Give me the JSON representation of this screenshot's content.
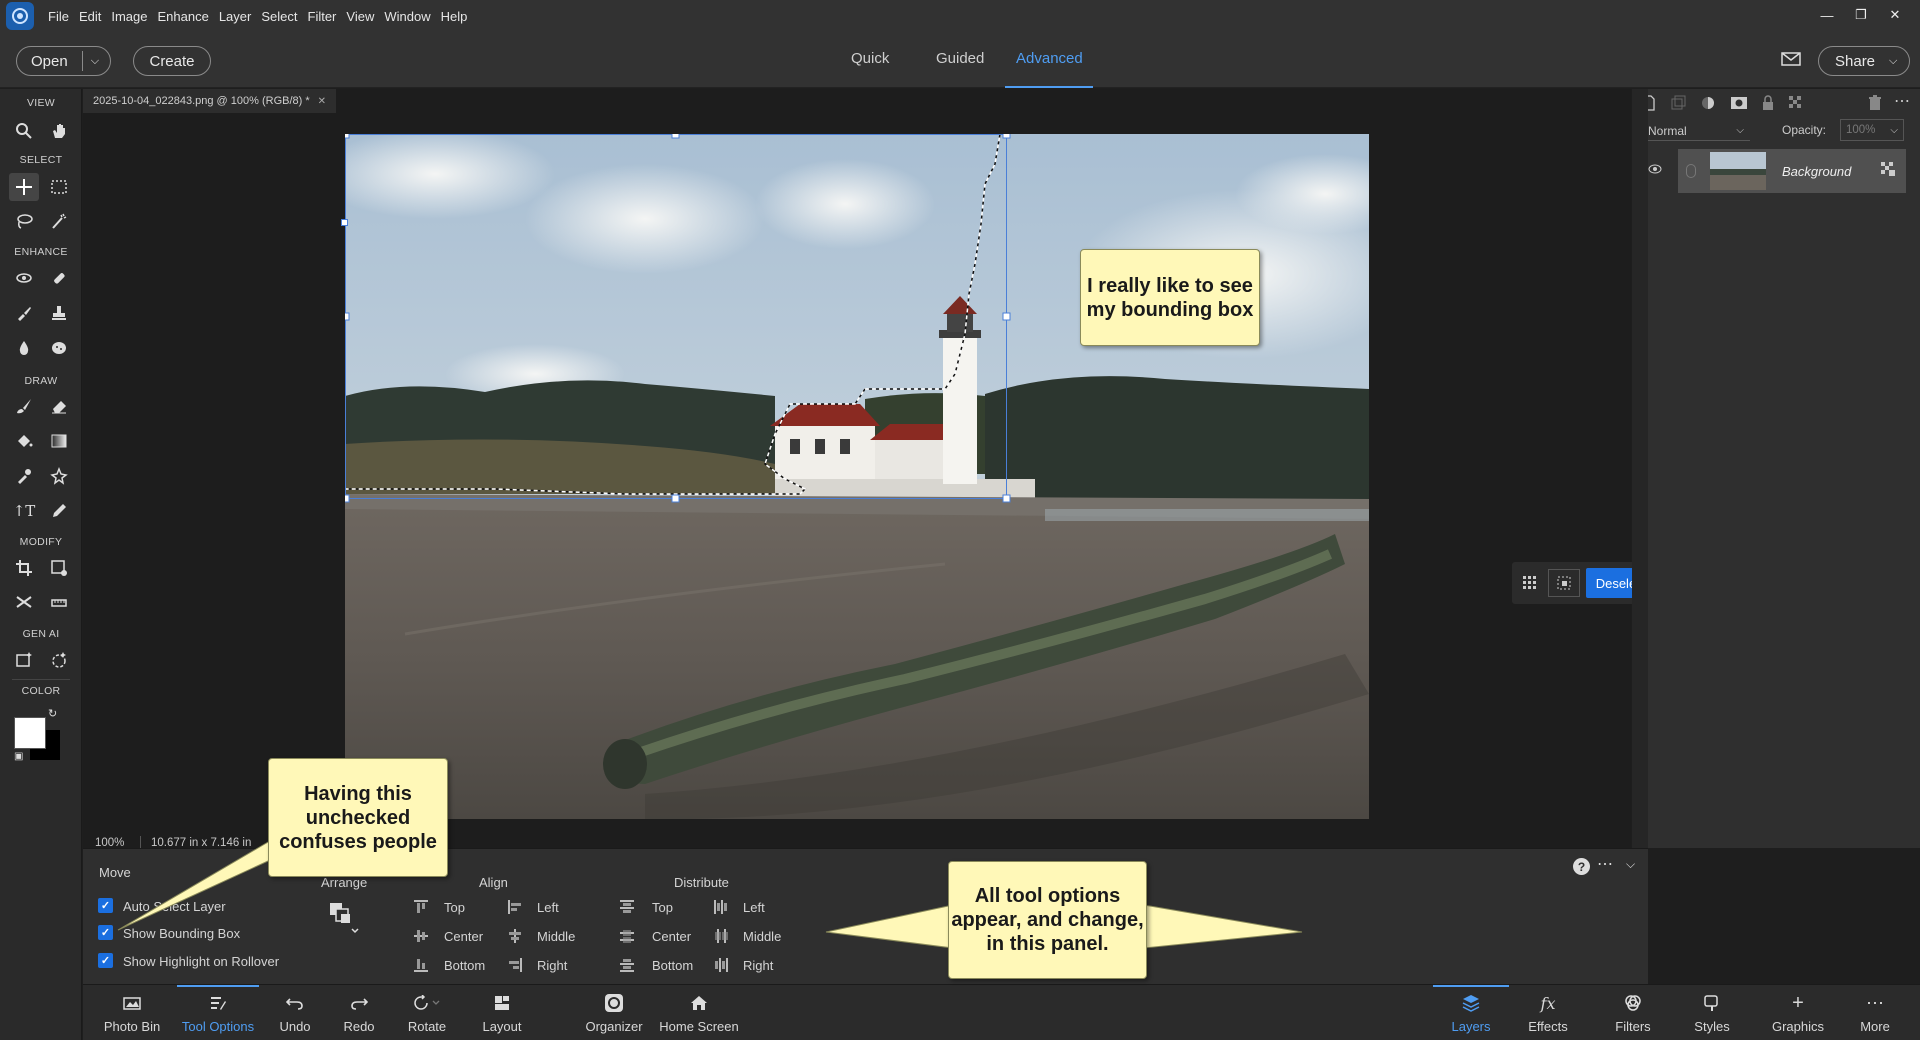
{
  "menu": [
    "File",
    "Edit",
    "Image",
    "Enhance",
    "Layer",
    "Select",
    "Filter",
    "View",
    "Window",
    "Help"
  ],
  "topbar": {
    "open_label": "Open",
    "create_label": "Create",
    "modes": [
      "Quick",
      "Guided",
      "Advanced"
    ],
    "active_mode": "Advanced",
    "share_label": "Share"
  },
  "toolbox": {
    "sections": [
      "VIEW",
      "SELECT",
      "ENHANCE",
      "DRAW",
      "MODIFY",
      "GEN AI",
      "COLOR"
    ]
  },
  "document": {
    "tab_title": "2025-10-04_022843.png @ 100% (RGB/8) *",
    "zoom": "100%",
    "size": "10.677 in x 7.146 in"
  },
  "float_bar": {
    "deselect_label": "Deselect"
  },
  "layers_panel": {
    "blend_mode": "Normal",
    "opacity_label": "Opacity:",
    "opacity_value": "100%",
    "layer_name": "Background"
  },
  "tool_options": {
    "tool_name": "Move",
    "checkboxes": [
      {
        "label": "Auto Select Layer",
        "checked": true
      },
      {
        "label": "Show Bounding Box",
        "checked": true
      },
      {
        "label": "Show Highlight on Rollover",
        "checked": true
      }
    ],
    "arrange_label": "Arrange",
    "align_label": "Align",
    "align_items": [
      "Top",
      "Center",
      "Bottom",
      "Left",
      "Middle",
      "Right"
    ],
    "distribute_label": "Distribute",
    "distribute_items": [
      "Top",
      "Center",
      "Bottom",
      "Left",
      "Middle",
      "Right"
    ]
  },
  "bottom_bar": {
    "left": [
      "Photo Bin",
      "Tool Options",
      "Undo",
      "Redo",
      "Rotate",
      "Layout",
      "Organizer",
      "Home Screen"
    ],
    "right": [
      "Layers",
      "Effects",
      "Filters",
      "Styles",
      "Graphics",
      "More"
    ],
    "active_left": "Tool Options",
    "active_right": "Layers"
  },
  "callouts": {
    "bounding_box": "I really like to see my bounding box",
    "unchecked": "Having this unchecked confuses people",
    "tool_options": "All tool options appear, and change, in this panel."
  },
  "colors": {
    "accent": "#4f9df2",
    "deselect": "#1b6fe0",
    "callout_bg": "#fff8b8"
  }
}
